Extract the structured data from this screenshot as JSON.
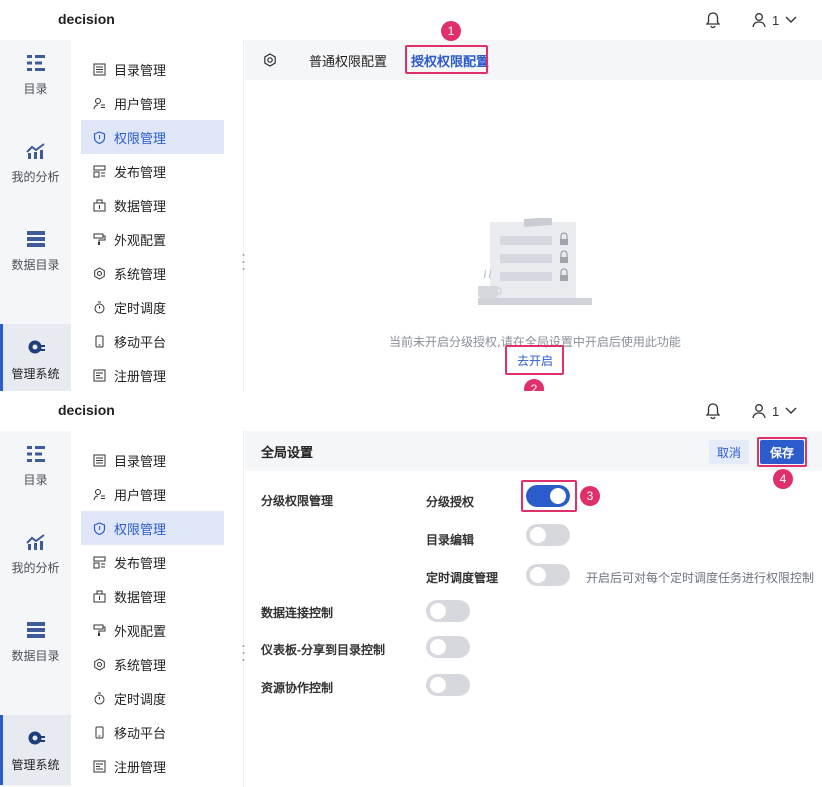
{
  "app": {
    "brand": "decision",
    "user_name": "1"
  },
  "rail": [
    "目录",
    "我的分析",
    "数据目录",
    "管理系统"
  ],
  "menu": [
    "目录管理",
    "用户管理",
    "权限管理",
    "发布管理",
    "数据管理",
    "外观配置",
    "系统管理",
    "定时调度",
    "移动平台",
    "注册管理"
  ],
  "top_panel": {
    "tabs": [
      "普通权限配置",
      "授权权限配置"
    ],
    "empty_message": "当前未开启分级授权,请在全局设置中开启后使用此功能",
    "enable_link": "去开启"
  },
  "bottom_panel": {
    "title": "全局设置",
    "cancel": "取消",
    "save": "保存",
    "section": "分级权限管理",
    "sub_settings": [
      {
        "label": "分级授权",
        "on": true
      },
      {
        "label": "目录编辑",
        "on": false
      },
      {
        "label": "定时调度管理",
        "on": false,
        "hint": "开启后可对每个定时调度任务进行权限控制"
      }
    ],
    "settings": [
      {
        "label": "数据连接控制",
        "on": false
      },
      {
        "label": "仪表板-分享到目录控制",
        "on": false
      },
      {
        "label": "资源协作控制",
        "on": false
      }
    ]
  },
  "steps": [
    "1",
    "2",
    "3",
    "4"
  ],
  "colors": {
    "accent": "#2c5ccc",
    "highlight": "#e0306a",
    "toggle_off": "#d6d8de"
  }
}
